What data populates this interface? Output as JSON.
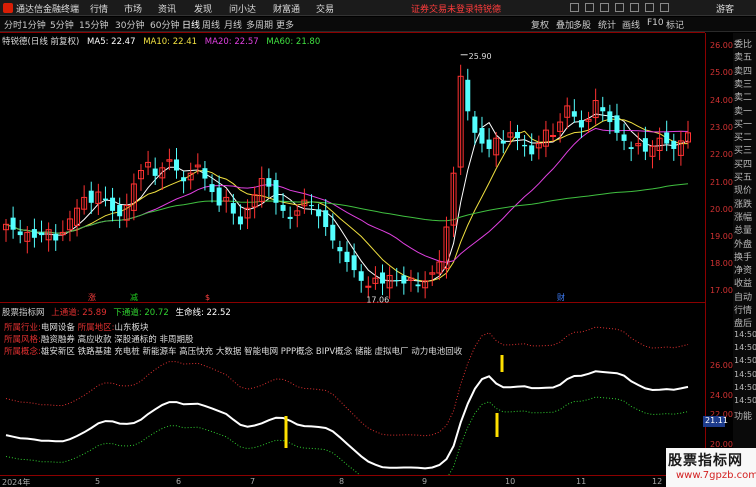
{
  "app": {
    "title": "通达信金融终端",
    "menus": [
      "行情",
      "市场",
      "资讯",
      "发现",
      "问小达",
      "财富通",
      "交易"
    ],
    "warning": "证券交易未登录",
    "account": "特锐德",
    "guest": "游客"
  },
  "toolbar": {
    "periods": [
      "分时",
      "1分钟",
      "5分钟",
      "15分钟",
      "30分钟",
      "60分钟",
      "日线",
      "周线",
      "月线",
      "多周期",
      "更多"
    ],
    "active_period": "日线",
    "tools": [
      "复权",
      "叠加",
      "多股",
      "统计",
      "画线",
      "F10",
      "标记"
    ]
  },
  "price_panel": {
    "stock": "特锐德(日线 前复权)",
    "ma5": "MA5: 22.47",
    "ma10": "MA10: 22.41",
    "ma20": "MA20: 22.57",
    "ma60": "MA60: 21.80",
    "high_label": "25.90",
    "low_label": "17.06",
    "markers": [
      {
        "text": "涨",
        "color": "#ff4040"
      },
      {
        "text": "减",
        "color": "#20d020"
      },
      {
        "text": "$",
        "color": "#ff4040"
      },
      {
        "text": "财",
        "color": "#4080ff"
      }
    ],
    "y_ticks": [
      "26.00",
      "25.00",
      "24.00",
      "23.00",
      "22.00",
      "21.00",
      "20.00",
      "19.00",
      "18.00",
      "17.00"
    ]
  },
  "indicator_panel": {
    "name": "股票指标网",
    "upper": "上通道: 25.89",
    "lower": "下通道: 20.72",
    "life": "生命线: 22.52",
    "industry_key": "所属行业:",
    "industry_val": "电网设备",
    "region_key": "所属地区:",
    "region_val": "山东板块",
    "style_key": "所属风格:",
    "style_val": "融资融券 高应收款 深股通标的 非周期股",
    "concept_key": "所属概念:",
    "concept_val": "雄安新区 铁路基建 充电桩 新能源车 高压快充 大数据 智能电网 PPP概念 BIPV概念 储能 虚拟电厂 动力电池回收",
    "y_ticks": [
      "26.00",
      "24.00",
      "22.00",
      "20.00"
    ],
    "current": "21.11"
  },
  "side_panel": {
    "items": [
      "委比",
      "卖五",
      "卖四",
      "卖三",
      "卖二",
      "卖一",
      "买一",
      "买二",
      "买三",
      "买四",
      "买五",
      "现价",
      "涨跌",
      "涨幅",
      "总量",
      "外盘",
      "换手",
      "净资",
      "收益",
      "自动",
      "行情",
      "盘后",
      "14:50",
      "14:50",
      "14:50",
      "14:50",
      "14:50",
      "14:50",
      "功能"
    ]
  },
  "time_axis": [
    "2024年",
    "5",
    "6",
    "7",
    "8",
    "9",
    "10",
    "11",
    "12"
  ],
  "watermark": {
    "big": "股票指标网",
    "small": "www.7gpzb.com"
  },
  "chart_data": {
    "type": "candlestick",
    "title": "特锐德(日线 前复权)",
    "ylim": [
      16.9,
      26.3
    ],
    "indicators": {
      "MA5": 22.47,
      "MA10": 22.41,
      "MA20": 22.57,
      "MA60": 21.8
    },
    "high": 25.9,
    "low": 17.06,
    "close_series": [
      19.6,
      19.4,
      19.2,
      19.3,
      19.1,
      19.2,
      19.4,
      19.0,
      19.3,
      19.8,
      20.2,
      20.6,
      20.4,
      20.8,
      20.5,
      20.1,
      19.9,
      20.3,
      21.1,
      21.6,
      21.9,
      21.4,
      21.7,
      22.0,
      21.6,
      21.2,
      21.5,
      21.8,
      21.3,
      20.8,
      20.3,
      20.6,
      20.0,
      19.6,
      20.2,
      20.7,
      21.3,
      21.0,
      20.4,
      20.1,
      19.8,
      20.1,
      20.5,
      20.3,
      19.9,
      19.5,
      19.0,
      18.6,
      18.2,
      17.9,
      17.5,
      17.3,
      17.6,
      17.4,
      17.7,
      17.5,
      17.4,
      17.6,
      17.3,
      17.5,
      17.8,
      18.2,
      19.5,
      21.5,
      25.1,
      23.8,
      23.0,
      22.6,
      22.4,
      22.8,
      22.6,
      23.0,
      22.8,
      22.5,
      22.2,
      22.6,
      23.1,
      22.9,
      23.4,
      24.0,
      23.6,
      23.2,
      23.5,
      24.2,
      23.8,
      23.4,
      23.0,
      22.7,
      22.4,
      22.6,
      22.3,
      22.5,
      22.8,
      22.6,
      22.4,
      22.7,
      23.0
    ]
  }
}
